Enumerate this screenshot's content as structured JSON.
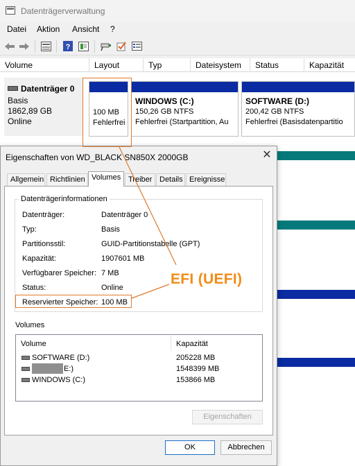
{
  "window": {
    "title": "Datenträgerverwaltung"
  },
  "menu": [
    "Datei",
    "Aktion",
    "Ansicht",
    "?"
  ],
  "toolbar": {
    "icons": [
      "back-arrow-icon",
      "forward-arrow-icon",
      "volume-list-icon",
      "help-icon",
      "properties-icon",
      "connect-icon",
      "check-icon",
      "settings-list-icon"
    ]
  },
  "columns": [
    "Volume",
    "Layout",
    "Typ",
    "Dateisystem",
    "Status",
    "Kapazität"
  ],
  "disk": {
    "name": "Datenträger 0",
    "type": "Basis",
    "size": "1862,89 GB",
    "status": "Online",
    "partitions": [
      {
        "title": "",
        "size": "100 MB",
        "status": "Fehlerfrei"
      },
      {
        "title": "WINDOWS  (C:)",
        "size": "150,26 GB NTFS",
        "status": "Fehlerfrei (Startpartition, Au"
      },
      {
        "title": "SOFTWARE  (D:)",
        "size": "200,42 GB NTFS",
        "status": "Fehlerfrei (Basisdatenpartitio"
      }
    ]
  },
  "colors": {
    "partition_bar": "#0a2ba1",
    "teal_strip": "#067a7a",
    "navy_strip": "#0a2ba1",
    "annotation": "#f28c18"
  },
  "dialog": {
    "title": "Eigenschaften von WD_BLACK SN850X 2000GB",
    "tabs": [
      "Allgemein",
      "Richtlinien",
      "Volumes",
      "Treiber",
      "Details",
      "Ereignisse"
    ],
    "active_tab": "Volumes",
    "group_title": "Datenträgerinformationen",
    "properties": [
      {
        "label": "Datenträger:",
        "value": "Datenträger 0"
      },
      {
        "label": "Typ:",
        "value": "Basis"
      },
      {
        "label": "Partitionsstil:",
        "value": "GUID-Partitionstabelle (GPT)"
      },
      {
        "label": "Kapazität:",
        "value": "1907601 MB"
      },
      {
        "label": "Verfügbarer Speicher:",
        "value": "7 MB"
      },
      {
        "label": "Status:",
        "value": "Online"
      },
      {
        "label": "Reservierter Speicher:",
        "value": "100 MB"
      }
    ],
    "volumes_heading": "Volumes",
    "volumes_columns": [
      "Volume",
      "Kapazität"
    ],
    "volumes": [
      {
        "name": "SOFTWARE (D:)",
        "capacity": "205228 MB"
      },
      {
        "name": "E:)",
        "capacity": "1548399 MB"
      },
      {
        "name": "WINDOWS (C:)",
        "capacity": "153866 MB"
      }
    ],
    "properties_button": "Eigenschaften",
    "ok_button": "OK",
    "cancel_button": "Abbrechen"
  },
  "annotation": {
    "text": "EFI (UEFI)"
  }
}
